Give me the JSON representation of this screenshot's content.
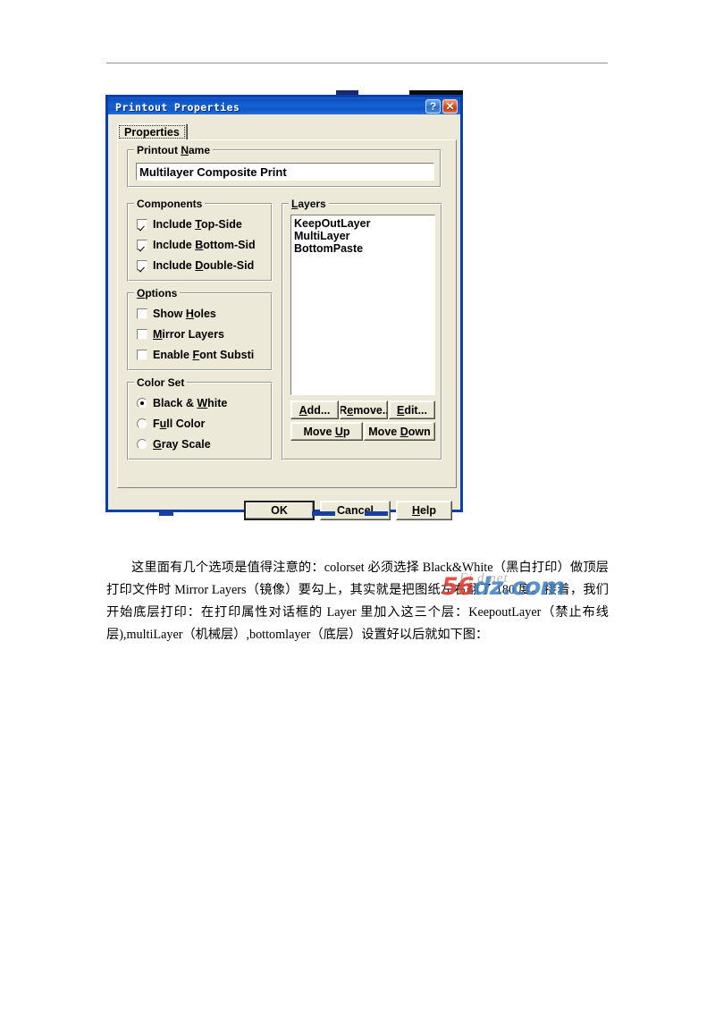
{
  "document": {
    "paragraph": "这里面有几个选项是值得注意的：colorset 必须选择 Black&White（黑白打印）做顶层打印文件时 Mirror Layers（镜像）要勾上，其实就是把图纸左右翻了 180 度。接着，我们开始底层打印：在打印属性对话框的 Layer 里加入这三个层：KeepoutLayer（禁止布线层),multiLayer（机械层）,bottomlayer（底层）设置好以后就如下图："
  },
  "watermark": {
    "text_red": "56",
    "text_blue": "dz.com",
    "ghost": "Fi d   net"
  },
  "dialog": {
    "title": "Printout Properties",
    "titlebar_buttons": [
      {
        "name": "help-button",
        "glyph": "?"
      },
      {
        "name": "close-button",
        "glyph": "✕"
      }
    ],
    "tabs": [
      {
        "label": "Properties",
        "selected": true
      }
    ],
    "printout_name": {
      "group_title": "Printout Name",
      "group_accel": "N",
      "value": "Multilayer Composite Print"
    },
    "components": {
      "group_title": "Components",
      "items": [
        {
          "label_pre": "Include ",
          "accel": "T",
          "label_post": "op-Side",
          "checked": true
        },
        {
          "label_pre": "Include ",
          "accel": "B",
          "label_post": "ottom-Sid",
          "checked": true
        },
        {
          "label_pre": "Include ",
          "accel": "D",
          "label_post": "ouble-Sid",
          "checked": true
        }
      ]
    },
    "options": {
      "group_title": "Options",
      "group_accel": "O",
      "items": [
        {
          "label_pre": "Show ",
          "accel": "H",
          "label_post": "oles",
          "checked": false
        },
        {
          "label_pre": "",
          "accel": "M",
          "label_post": "irror Layers",
          "checked": false
        },
        {
          "label_pre": "Enable ",
          "accel": "F",
          "label_post": "ont Substi",
          "checked": false
        }
      ]
    },
    "color_set": {
      "group_title": "Color Set",
      "items": [
        {
          "label_pre": "Black & ",
          "accel": "W",
          "label_post": "hite",
          "selected": true
        },
        {
          "label_pre": "F",
          "accel": "u",
          "label_post": "ll Color",
          "selected": false
        },
        {
          "label_pre": "",
          "accel": "G",
          "label_post": "ray Scale",
          "selected": false
        }
      ]
    },
    "layers": {
      "group_title": "Layers",
      "group_accel": "L",
      "items": [
        {
          "name": "KeepOutLayer"
        },
        {
          "name": "MultiLayer"
        },
        {
          "name": "BottomPaste"
        }
      ],
      "buttons": [
        {
          "label_pre": "",
          "accel": "A",
          "label_post": "dd...",
          "name": "add-button"
        },
        {
          "label_pre": "R",
          "accel": "e",
          "label_post": "move..",
          "name": "remove-button"
        },
        {
          "label_pre": "",
          "accel": "E",
          "label_post": "dit...",
          "name": "edit-button"
        },
        {
          "label_pre": "Move ",
          "accel": "U",
          "label_post": "p",
          "name": "move-up-button"
        },
        {
          "label_pre": "Move ",
          "accel": "D",
          "label_post": "own",
          "name": "move-down-button"
        }
      ]
    },
    "footer_buttons": [
      {
        "label_pre": "OK",
        "accel": "",
        "label_post": "",
        "name": "ok-button",
        "default": true
      },
      {
        "label_pre": "Cancel",
        "accel": "",
        "label_post": "",
        "name": "cancel-button",
        "default": false
      },
      {
        "label_pre": "",
        "accel": "H",
        "label_post": "elp",
        "name": "help-button",
        "default": false
      }
    ]
  },
  "colors": {
    "dialog_face": "#ece9d8",
    "title_blue": "#0a4fc2",
    "border_blue": "#0a3fa8",
    "watermark_red": "#e03a2e",
    "watermark_blue": "#3f7fc1"
  }
}
